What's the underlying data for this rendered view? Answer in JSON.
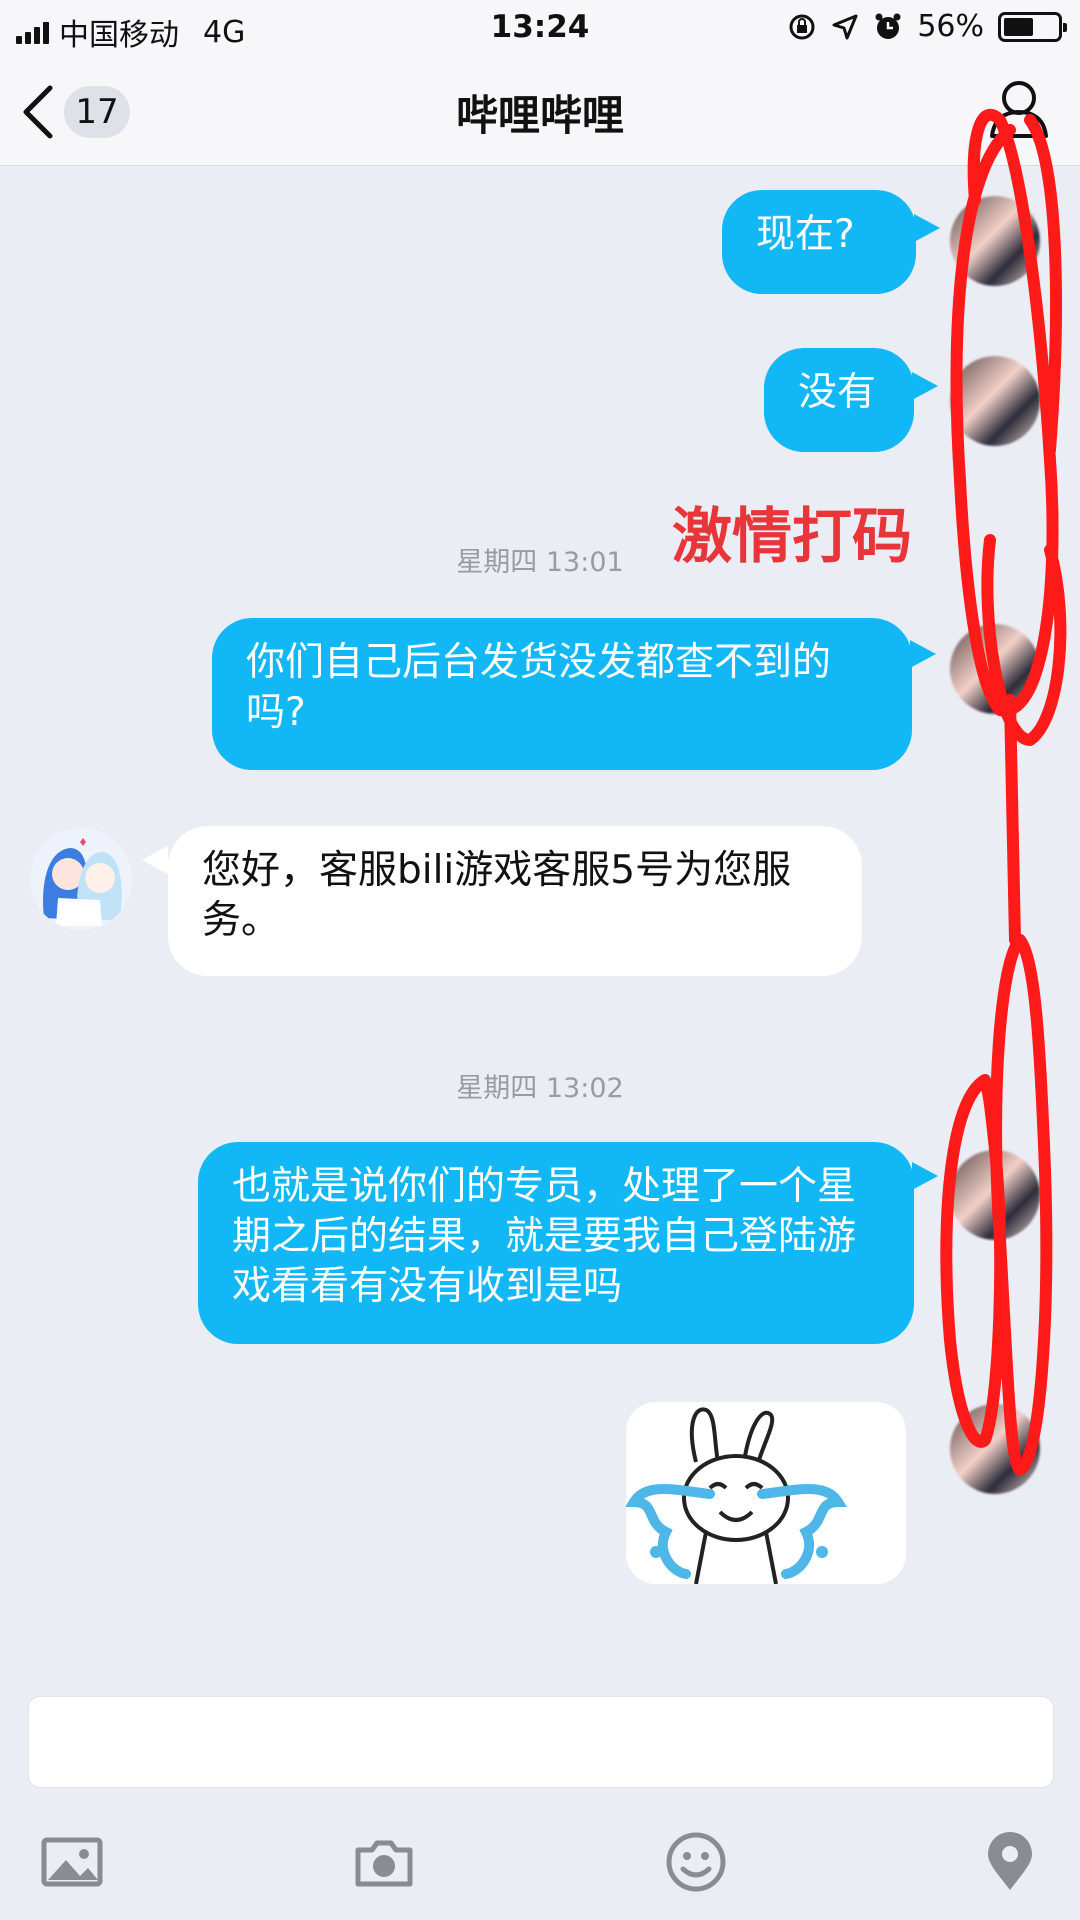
{
  "status_bar": {
    "carrier": "中国移动",
    "network": "4G",
    "time": "13:24",
    "battery_percent": "56%",
    "battery_level": 0.56,
    "icons": [
      "lock-rotation-icon",
      "location-arrow-icon",
      "alarm-icon"
    ]
  },
  "nav": {
    "back_icon": "chevron-left-icon",
    "unread_count": "17",
    "title": "哔哩哔哩",
    "profile_icon": "person-icon"
  },
  "messages": [
    {
      "type": "sent",
      "text": "现在?"
    },
    {
      "type": "sent",
      "text": "没有"
    },
    {
      "type": "time",
      "text": "星期四 13:01"
    },
    {
      "type": "sent",
      "text": "你们自己后台发货没发都查不到的吗?"
    },
    {
      "type": "received",
      "text": "您好，客服bili游戏客服5号为您服务。"
    },
    {
      "type": "time",
      "text": "星期四 13:02"
    },
    {
      "type": "sent",
      "text": "也就是说你们的专员，处理了一个星期之后的结果，就是要我自己登陆游戏看看有没有收到是吗"
    },
    {
      "type": "sent-sticker",
      "description_icon": "crying-rabbit-sticker"
    }
  ],
  "annotation": {
    "text": "激情打码",
    "color": "#e8353a"
  },
  "input": {
    "placeholder": ""
  },
  "toolbar": {
    "icons": [
      "image-icon",
      "camera-icon",
      "emoji-icon",
      "location-pin-icon"
    ]
  },
  "colors": {
    "sent_bubble": "#12b7f5",
    "received_bubble": "#ffffff",
    "background": "#ebedf5",
    "scribble": "#ff1a1a"
  }
}
